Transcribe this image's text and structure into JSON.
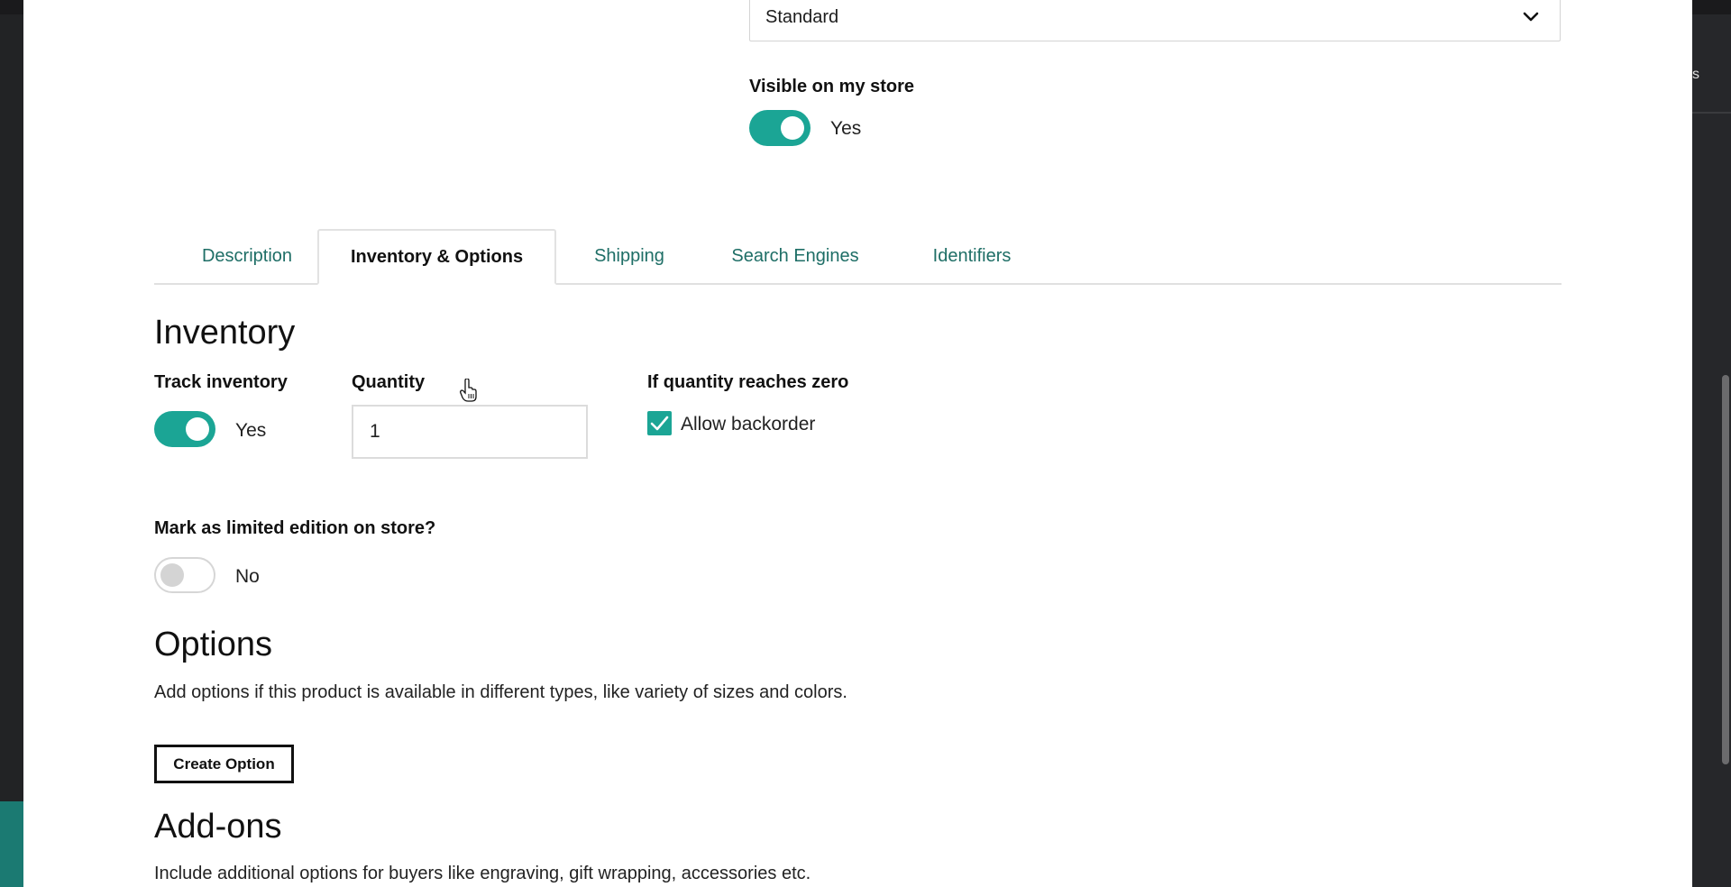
{
  "top": {
    "shipping_select": {
      "value": "Standard",
      "icon": "chevron-down-icon"
    },
    "visible_on_store": {
      "label": "Visible on my store",
      "state": true,
      "state_text": "Yes"
    }
  },
  "tabs": [
    {
      "label": "Description",
      "active": false
    },
    {
      "label": "Inventory & Options",
      "active": true
    },
    {
      "label": "Shipping",
      "active": false
    },
    {
      "label": "Search Engines",
      "active": false
    },
    {
      "label": "Identifiers",
      "active": false
    }
  ],
  "inventory": {
    "heading": "Inventory",
    "track_inventory": {
      "label": "Track inventory",
      "state": true,
      "state_text": "Yes"
    },
    "quantity": {
      "label": "Quantity",
      "value": "1"
    },
    "zero_quantity": {
      "label": "If quantity reaches zero",
      "checkbox_label": "Allow backorder",
      "checked": true
    },
    "limited_edition": {
      "label": "Mark as limited edition on store?",
      "state": false,
      "state_text": "No"
    }
  },
  "options": {
    "heading": "Options",
    "description": "Add options if this product is available in different types, like variety of sizes and colors.",
    "create_button": "Create Option"
  },
  "addons": {
    "heading": "Add-ons",
    "description": "Include additional options for buyers like engraving, gift wrapping, accessories etc."
  },
  "backdrop": {
    "right_peek_text": "s"
  },
  "colors": {
    "accent": "#1ba595",
    "tab_link": "#1e6e66",
    "backdrop_dark": "#222325",
    "teal_strip": "#1b7a72"
  }
}
